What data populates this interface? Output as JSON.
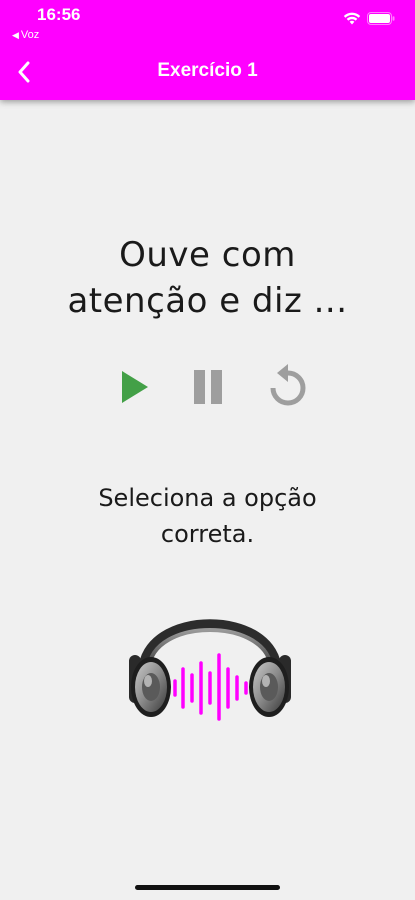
{
  "status_bar": {
    "time": "16:56",
    "back_app": "Voz",
    "icons": [
      "wifi-icon",
      "battery-icon"
    ]
  },
  "nav": {
    "title": "Exercício 1",
    "back_icon": "chevron-left-icon"
  },
  "prompt": {
    "line1": "Ouve com",
    "line2": "atenção e diz ..."
  },
  "controls": [
    {
      "name": "play",
      "icon": "play-icon",
      "color": "#43a047"
    },
    {
      "name": "pause",
      "icon": "pause-icon",
      "color": "#9e9e9e"
    },
    {
      "name": "replay",
      "icon": "replay-icon",
      "color": "#9e9e9e"
    }
  ],
  "instruction": {
    "line1": "Seleciona a opção",
    "line2": "correta."
  },
  "illustration": {
    "icon": "headphones-soundwave-icon",
    "wave_color": "#ff00ff"
  },
  "colors": {
    "accent": "#ff00ff",
    "background": "#f0f0f0",
    "text": "#1a1a1a"
  }
}
